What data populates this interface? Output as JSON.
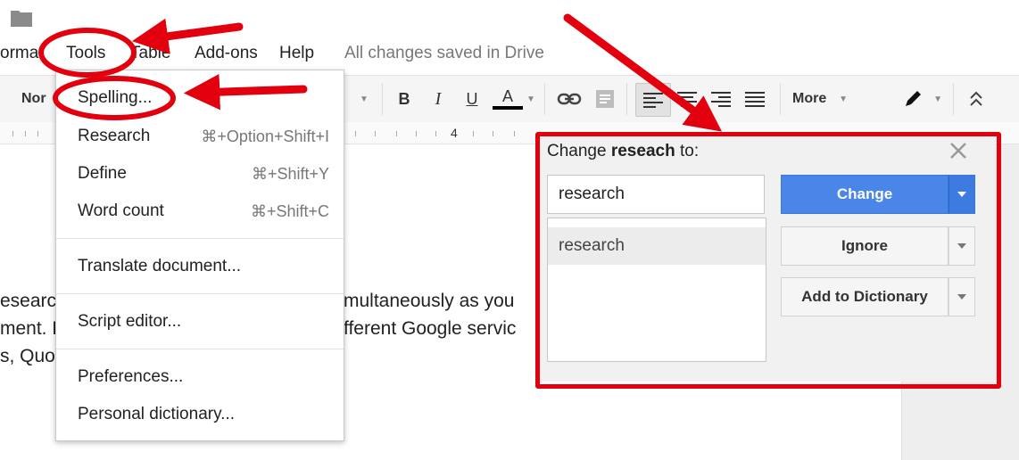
{
  "menubar": {
    "items": [
      {
        "label": "ormat"
      },
      {
        "label": "Tools"
      },
      {
        "label": "Table"
      },
      {
        "label": "Add-ons"
      },
      {
        "label": "Help"
      }
    ],
    "status": "All changes saved in Drive"
  },
  "toolbar": {
    "style_label": "Nor",
    "bold_label": "B",
    "italic_label": "I",
    "underline_label": "U",
    "text_color_label": "A",
    "more_label": "More",
    "icons": [
      "link-icon",
      "comment-icon",
      "align-left-icon",
      "align-center-icon",
      "align-right-icon",
      "align-justify-icon",
      "pen-icon",
      "collapse-icon"
    ]
  },
  "ruler": {
    "marker": "4"
  },
  "document": {
    "lines": [
      {
        "left": "esearc",
        "right": "multaneously as you"
      },
      {
        "left": "ment. F",
        "right": "fferent Google servic"
      },
      {
        "left": "s, Quo",
        "right": ""
      }
    ]
  },
  "tools_menu": {
    "items": [
      {
        "label": "Spelling...",
        "shortcut": ""
      },
      {
        "label": "Research",
        "shortcut": "⌘+Option+Shift+I"
      },
      {
        "label": "Define",
        "shortcut": "⌘+Shift+Y"
      },
      {
        "label": "Word count",
        "shortcut": "⌘+Shift+C"
      },
      {
        "label": "Translate document...",
        "shortcut": ""
      },
      {
        "label": "Script editor...",
        "shortcut": ""
      },
      {
        "label": "Preferences...",
        "shortcut": ""
      },
      {
        "label": "Personal dictionary...",
        "shortcut": ""
      }
    ]
  },
  "spelling_dialog": {
    "title_prefix": "Change",
    "misspelled_word": "reseach",
    "title_suffix": "to:",
    "replacement_value": "research",
    "suggestions": [
      "research"
    ],
    "change_label": "Change",
    "ignore_label": "Ignore",
    "add_label": "Add to Dictionary"
  },
  "colors": {
    "accent_blue": "#4a86e8",
    "annotation_red": "#e2000f",
    "toolbar_bg": "#f5f5f5",
    "dialog_bg": "#f1f1f1"
  }
}
